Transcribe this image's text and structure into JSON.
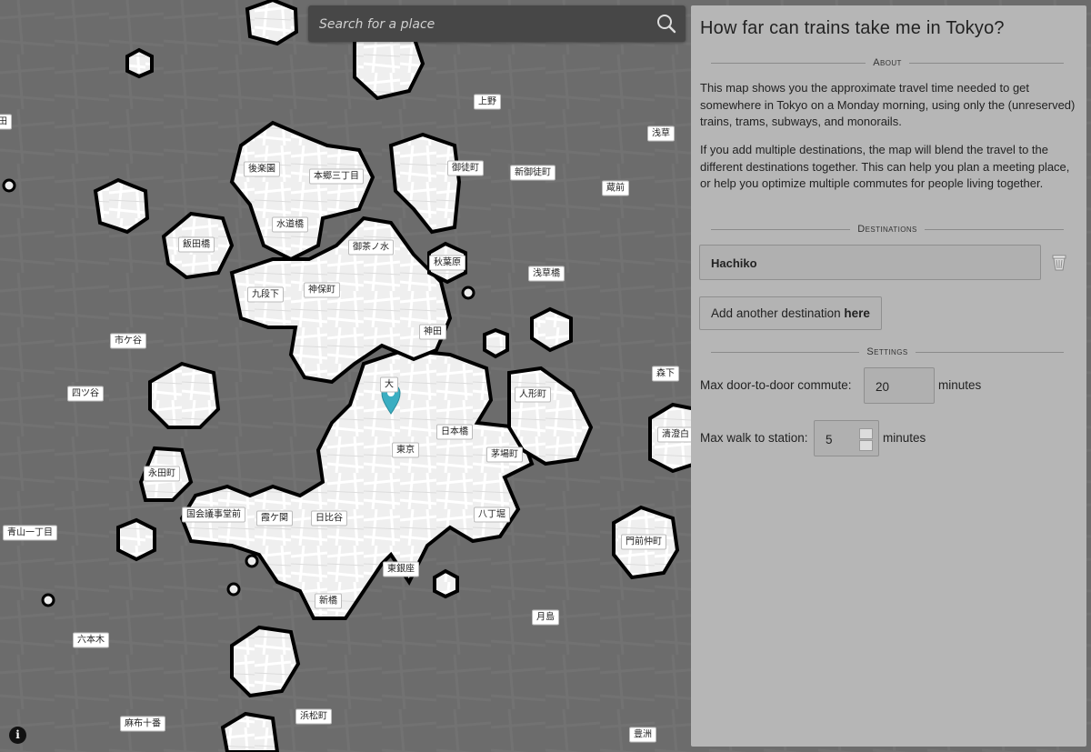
{
  "search": {
    "placeholder": "Search for a place"
  },
  "map": {
    "labels": [
      {
        "text": "上野"
      },
      {
        "text": "浅草"
      },
      {
        "text": "後楽園"
      },
      {
        "text": "本郷三丁目"
      },
      {
        "text": "御徒町"
      },
      {
        "text": "新御徒町"
      },
      {
        "text": "蔵前"
      },
      {
        "text": "飯田橋"
      },
      {
        "text": "水道橋"
      },
      {
        "text": "御茶ノ水"
      },
      {
        "text": "秋葉原"
      },
      {
        "text": "浅草橋"
      },
      {
        "text": "九段下"
      },
      {
        "text": "神保町"
      },
      {
        "text": "神田"
      },
      {
        "text": "市ケ谷"
      },
      {
        "text": "森下"
      },
      {
        "text": "四ツ谷"
      },
      {
        "text": "人形町"
      },
      {
        "text": "日本橋"
      },
      {
        "text": "清澄白"
      },
      {
        "text": "東京"
      },
      {
        "text": "茅場町"
      },
      {
        "text": "永田町"
      },
      {
        "text": "国会議事堂前"
      },
      {
        "text": "霞ケ関"
      },
      {
        "text": "日比谷"
      },
      {
        "text": "八丁堀"
      },
      {
        "text": "青山一丁目"
      },
      {
        "text": "門前仲町"
      },
      {
        "text": "東銀座"
      },
      {
        "text": "新橋"
      },
      {
        "text": "月島"
      },
      {
        "text": "六本木"
      },
      {
        "text": "浜松町"
      },
      {
        "text": "麻布十番"
      },
      {
        "text": "豊洲"
      },
      {
        "text": "田"
      },
      {
        "text": "大"
      }
    ],
    "info_icon": "info-icon",
    "marker_icon": "location-pin-icon",
    "marker_color": "#3aaec2"
  },
  "panel": {
    "title": "How far can trains take me in Tokyo?",
    "about_heading": "About",
    "about_p1": "This map shows you the approximate travel time needed to get somewhere in Tokyo on a Monday morning, using only the (unreserved) trains, trams, subways, and monorails.",
    "about_p2": "If you add multiple destinations, the map will blend the travel to the different destinations together. This can help you plan a meeting place, or help you optimize multiple commutes for people living together.",
    "destinations_heading": "Destinations",
    "destination_value": "Hachiko",
    "add_btn_text": "Add another destination ",
    "add_btn_bold": "here",
    "settings_heading": "Settings",
    "commute_label": "Max door-to-door commute:",
    "commute_value": "20",
    "commute_unit": "minutes",
    "walk_label": "Max walk to station:",
    "walk_value": "5",
    "walk_unit": "minutes"
  }
}
